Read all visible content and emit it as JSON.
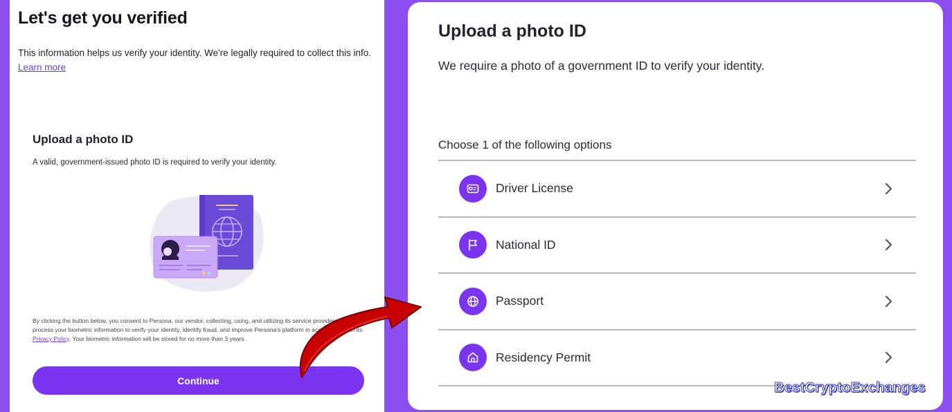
{
  "left": {
    "title": "Let's get you verified",
    "intro_text": "This information helps us verify your identity. We're legally required to collect this info.",
    "learn_more": "Learn more",
    "card_title": "Upload a photo ID",
    "card_desc": "A valid, government-issued photo ID is required to verify your identity.",
    "consent_text_1": "By clicking the button below, you consent to Persona, our vendor, collecting, using, and utilizing its service providers to process your biometric information to verify your identity, identify fraud, and improve Persona's platform in accordance with its",
    "privacy_policy": "Privacy Policy",
    "consent_text_2": ". Your biometric information will be stored for no more than 3 years.",
    "continue_label": "Continue"
  },
  "right": {
    "title": "Upload a photo ID",
    "desc": "We require a photo of a government ID to verify your identity.",
    "choose_label": "Choose 1 of the following options",
    "options": [
      {
        "label": "Driver License",
        "icon": "id-card-icon"
      },
      {
        "label": "National ID",
        "icon": "flag-icon"
      },
      {
        "label": "Passport",
        "icon": "globe-icon"
      },
      {
        "label": "Residency Permit",
        "icon": "home-icon"
      }
    ]
  },
  "watermark": "BestCryptoExchanges",
  "colors": {
    "accent": "#7b35f1",
    "background": "#8b4ff0",
    "arrow": "#cc0000"
  }
}
